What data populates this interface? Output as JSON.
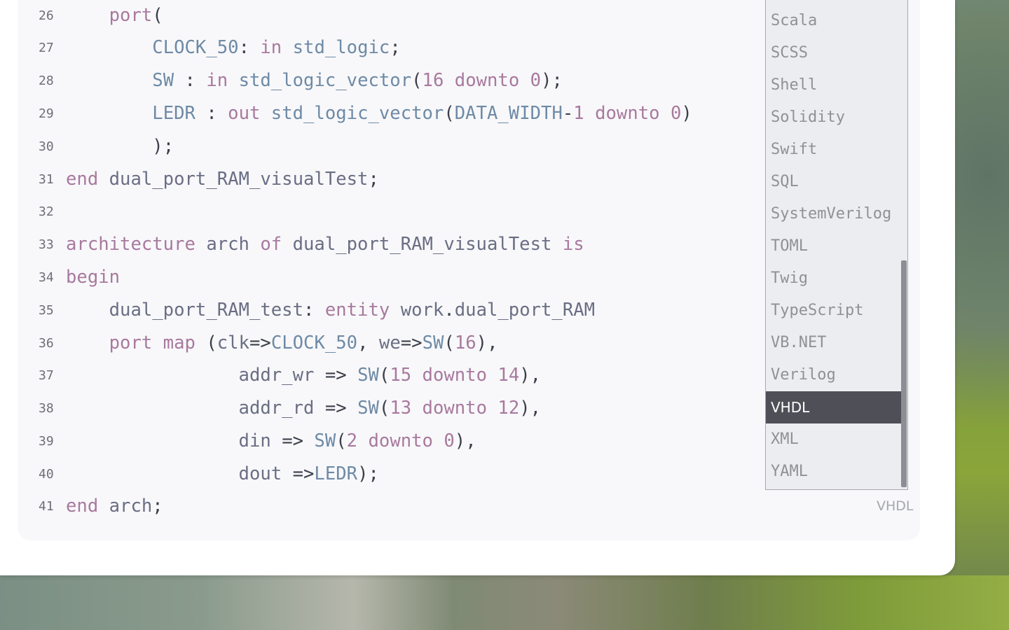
{
  "code": {
    "lines": [
      {
        "no": "26",
        "tokens": [
          {
            "t": "    "
          },
          {
            "t": "port",
            "c": "kw"
          },
          {
            "t": "(",
            "c": "pn"
          }
        ]
      },
      {
        "no": "27",
        "tokens": [
          {
            "t": "        "
          },
          {
            "t": "CLOCK_50",
            "c": "ty"
          },
          {
            "t": ": ",
            "c": "pn"
          },
          {
            "t": "in",
            "c": "kw"
          },
          {
            "t": " std_logic",
            "c": "ty"
          },
          {
            "t": ";",
            "c": "pn"
          }
        ]
      },
      {
        "no": "28",
        "tokens": [
          {
            "t": "        "
          },
          {
            "t": "SW",
            "c": "ty"
          },
          {
            "t": " : ",
            "c": "pn"
          },
          {
            "t": "in",
            "c": "kw"
          },
          {
            "t": " std_logic_vector",
            "c": "ty"
          },
          {
            "t": "(",
            "c": "pn"
          },
          {
            "t": "16",
            "c": "num"
          },
          {
            "t": " downto ",
            "c": "kw"
          },
          {
            "t": "0",
            "c": "num"
          },
          {
            "t": ");",
            "c": "pn"
          }
        ]
      },
      {
        "no": "29",
        "tokens": [
          {
            "t": "        "
          },
          {
            "t": "LEDR",
            "c": "ty"
          },
          {
            "t": " : ",
            "c": "pn"
          },
          {
            "t": "out",
            "c": "kw"
          },
          {
            "t": " std_logic_vector",
            "c": "ty"
          },
          {
            "t": "(",
            "c": "pn"
          },
          {
            "t": "DATA_WIDTH",
            "c": "ty"
          },
          {
            "t": "-",
            "c": "pn"
          },
          {
            "t": "1",
            "c": "num"
          },
          {
            "t": " downto ",
            "c": "kw"
          },
          {
            "t": "0",
            "c": "num"
          },
          {
            "t": ")",
            "c": "pn"
          }
        ]
      },
      {
        "no": "30",
        "tokens": [
          {
            "t": "        "
          },
          {
            "t": ");",
            "c": "pn"
          }
        ]
      },
      {
        "no": "31",
        "tokens": [
          {
            "t": "end",
            "c": "kw"
          },
          {
            "t": " dual_port_RAM_visualTest",
            "c": "id"
          },
          {
            "t": ";",
            "c": "pn"
          }
        ]
      },
      {
        "no": "32",
        "tokens": []
      },
      {
        "no": "33",
        "tokens": [
          {
            "t": "architecture",
            "c": "kw"
          },
          {
            "t": " arch ",
            "c": "id"
          },
          {
            "t": "of",
            "c": "kw"
          },
          {
            "t": " dual_port_RAM_visualTest ",
            "c": "id"
          },
          {
            "t": "is",
            "c": "kw"
          }
        ]
      },
      {
        "no": "34",
        "tokens": [
          {
            "t": "begin",
            "c": "kw"
          }
        ]
      },
      {
        "no": "35",
        "tokens": [
          {
            "t": "    "
          },
          {
            "t": "dual_port_RAM_test",
            "c": "id"
          },
          {
            "t": ": ",
            "c": "pn"
          },
          {
            "t": "entity",
            "c": "kw"
          },
          {
            "t": " work",
            "c": "id"
          },
          {
            "t": ".",
            "c": "pn"
          },
          {
            "t": "dual_port_RAM",
            "c": "id"
          }
        ]
      },
      {
        "no": "36",
        "tokens": [
          {
            "t": "    "
          },
          {
            "t": "port map",
            "c": "kw"
          },
          {
            "t": " (",
            "c": "pn"
          },
          {
            "t": "clk",
            "c": "id"
          },
          {
            "t": "=>",
            "c": "pn"
          },
          {
            "t": "CLOCK_50",
            "c": "ty"
          },
          {
            "t": ", ",
            "c": "pn"
          },
          {
            "t": "we",
            "c": "id"
          },
          {
            "t": "=>",
            "c": "pn"
          },
          {
            "t": "SW",
            "c": "ty"
          },
          {
            "t": "(",
            "c": "pn"
          },
          {
            "t": "16",
            "c": "num"
          },
          {
            "t": "),",
            "c": "pn"
          }
        ]
      },
      {
        "no": "37",
        "tokens": [
          {
            "t": "                "
          },
          {
            "t": "addr_wr",
            "c": "id"
          },
          {
            "t": " => ",
            "c": "pn"
          },
          {
            "t": "SW",
            "c": "ty"
          },
          {
            "t": "(",
            "c": "pn"
          },
          {
            "t": "15",
            "c": "num"
          },
          {
            "t": " downto ",
            "c": "kw"
          },
          {
            "t": "14",
            "c": "num"
          },
          {
            "t": "),",
            "c": "pn"
          }
        ]
      },
      {
        "no": "38",
        "tokens": [
          {
            "t": "                "
          },
          {
            "t": "addr_rd",
            "c": "id"
          },
          {
            "t": " => ",
            "c": "pn"
          },
          {
            "t": "SW",
            "c": "ty"
          },
          {
            "t": "(",
            "c": "pn"
          },
          {
            "t": "13",
            "c": "num"
          },
          {
            "t": " downto ",
            "c": "kw"
          },
          {
            "t": "12",
            "c": "num"
          },
          {
            "t": "),",
            "c": "pn"
          }
        ]
      },
      {
        "no": "39",
        "tokens": [
          {
            "t": "                "
          },
          {
            "t": "din",
            "c": "id"
          },
          {
            "t": " => ",
            "c": "pn"
          },
          {
            "t": "SW",
            "c": "ty"
          },
          {
            "t": "(",
            "c": "pn"
          },
          {
            "t": "2",
            "c": "num"
          },
          {
            "t": " downto ",
            "c": "kw"
          },
          {
            "t": "0",
            "c": "num"
          },
          {
            "t": "),",
            "c": "pn"
          }
        ]
      },
      {
        "no": "40",
        "tokens": [
          {
            "t": "                "
          },
          {
            "t": "dout",
            "c": "id"
          },
          {
            "t": " =>",
            "c": "pn"
          },
          {
            "t": "LEDR",
            "c": "ty"
          },
          {
            "t": ");",
            "c": "pn"
          }
        ]
      },
      {
        "no": "41",
        "tokens": [
          {
            "t": "end",
            "c": "kw"
          },
          {
            "t": " arch",
            "c": "id"
          },
          {
            "t": ";",
            "c": "pn"
          }
        ]
      }
    ]
  },
  "language_menu": {
    "items": [
      "Scala",
      "SCSS",
      "Shell",
      "Solidity",
      "Swift",
      "SQL",
      "SystemVerilog",
      "TOML",
      "Twig",
      "TypeScript",
      "VB.NET",
      "Verilog",
      "VHDL",
      "XML",
      "YAML"
    ],
    "selected": "VHDL"
  },
  "current_language": "VHDL",
  "colors": {
    "keyword": "#a8799e",
    "type": "#6e8aa6",
    "selected_bg": "#4f4f58"
  }
}
